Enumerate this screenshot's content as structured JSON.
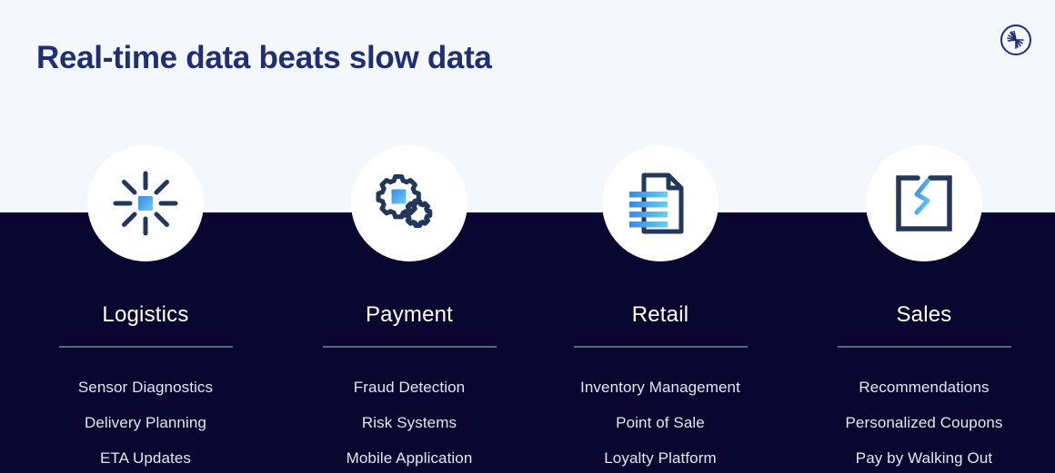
{
  "header": {
    "title": "Real-time data beats slow data",
    "logo_icon": "burst-asterisk-logo-icon"
  },
  "theme": {
    "light_background": "#f4f7fc",
    "dark_background": "#0a0630",
    "title_color": "#1f2f72",
    "icon_dark": "#23375c",
    "icon_accent_from": "#3b86e8",
    "icon_accent_to": "#64d2ec",
    "divider_color": "#5c7b9b",
    "column_title_color": "#ffffff",
    "item_text_color": "#e3e6ef"
  },
  "columns": [
    {
      "id": "logistics",
      "title": "Logistics",
      "icon": "burst-radial-icon",
      "items": [
        "Sensor Diagnostics",
        "Delivery Planning",
        "ETA Updates"
      ]
    },
    {
      "id": "payment",
      "title": "Payment",
      "icon": "gears-icon",
      "items": [
        "Fraud Detection",
        "Risk Systems",
        "Mobile Application"
      ]
    },
    {
      "id": "retail",
      "title": "Retail",
      "icon": "document-lines-icon",
      "items": [
        "Inventory Management",
        "Point of Sale",
        "Loyalty Platform"
      ]
    },
    {
      "id": "sales",
      "title": "Sales",
      "icon": "bracket-lightning-icon",
      "items": [
        "Recommendations",
        "Personalized Coupons",
        "Pay by Walking Out"
      ]
    }
  ]
}
